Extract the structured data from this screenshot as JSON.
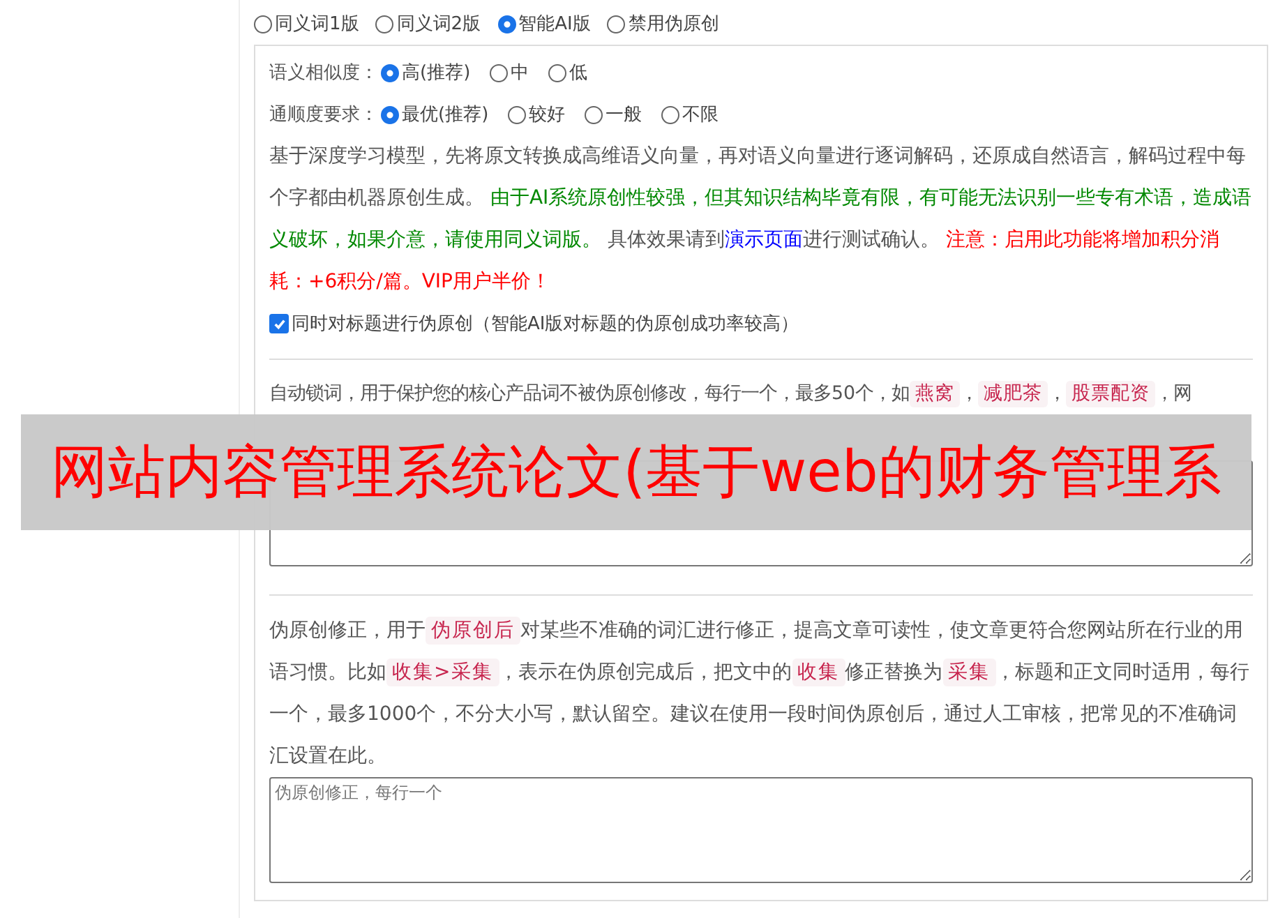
{
  "modes": [
    {
      "label": "同义词1版",
      "selected": false
    },
    {
      "label": "同义词2版",
      "selected": false
    },
    {
      "label": "智能AI版",
      "selected": true
    },
    {
      "label": "禁用伪原创",
      "selected": false
    }
  ],
  "similarity": {
    "label": "语义相似度：",
    "options": [
      {
        "label": "高(推荐)",
        "selected": true
      },
      {
        "label": "中",
        "selected": false
      },
      {
        "label": "低",
        "selected": false
      }
    ]
  },
  "fluency": {
    "label": "通顺度要求：",
    "options": [
      {
        "label": "最优(推荐)",
        "selected": true
      },
      {
        "label": "较好",
        "selected": false
      },
      {
        "label": "一般",
        "selected": false
      },
      {
        "label": "不限",
        "selected": false
      }
    ]
  },
  "description": [
    {
      "kind": "plain",
      "text": "基于深度学习模型，先将原文转换成高维语义向量，再对语义向量进行逐词解码，还原成自然语言，解码过程中每个字都由机器原创生成。 "
    },
    {
      "kind": "green",
      "text": "由于AI系统原创性较强，但其知识结构毕竟有限，有可能无法识别一些专有术语，造成语义破坏，如果介意，请使用同义词版。"
    },
    {
      "kind": "plain",
      "text": " 具体效果请到"
    },
    {
      "kind": "link",
      "text": "演示页面"
    },
    {
      "kind": "plain",
      "text": "进行测试确认。 "
    },
    {
      "kind": "red",
      "text": "注意：启用此功能将增加积分消耗：+6积分/篇。VIP用户半价！"
    }
  ],
  "title_option": {
    "label": "同时对标题进行伪原创（智能AI版对标题的伪原创成功率较高）",
    "checked": true
  },
  "lock_words": {
    "description": [
      {
        "kind": "plain",
        "text": "自动锁词，用于保护您的核心产品词不被伪原创修改，每行一个，最多50个，如"
      },
      {
        "kind": "tag",
        "text": "燕窝"
      },
      {
        "kind": "plain",
        "text": "，"
      },
      {
        "kind": "tag",
        "text": "减肥茶"
      },
      {
        "kind": "plain",
        "text": "，"
      },
      {
        "kind": "tag",
        "text": "股票配资"
      },
      {
        "kind": "plain",
        "text": "，网"
      }
    ]
  },
  "corrections": {
    "description": [
      {
        "kind": "plain",
        "text": "伪原创修正，用于"
      },
      {
        "kind": "tag",
        "text": "伪原创后"
      },
      {
        "kind": "plain",
        "text": "对某些不准确的词汇进行修正，提高文章可读性，使文章更符合您网站所在行业的用语习惯。比如"
      },
      {
        "kind": "tag",
        "text": "收集>采集"
      },
      {
        "kind": "plain",
        "text": "，表示在伪原创完成后，把文中的"
      },
      {
        "kind": "tag",
        "text": "收集"
      },
      {
        "kind": "plain",
        "text": "修正替换为"
      },
      {
        "kind": "tag",
        "text": "采集"
      },
      {
        "kind": "plain",
        "text": "，标题和正文同时适用，每行一个，最多1000个，不分大小写，默认留空。建议在使用一段时间伪原创后，通过人工审核，把常见的不准确词汇设置在此。"
      }
    ],
    "placeholder": "伪原创修正，每行一个"
  },
  "banner": "网站内容管理系统论文(基于web的财务管理系"
}
